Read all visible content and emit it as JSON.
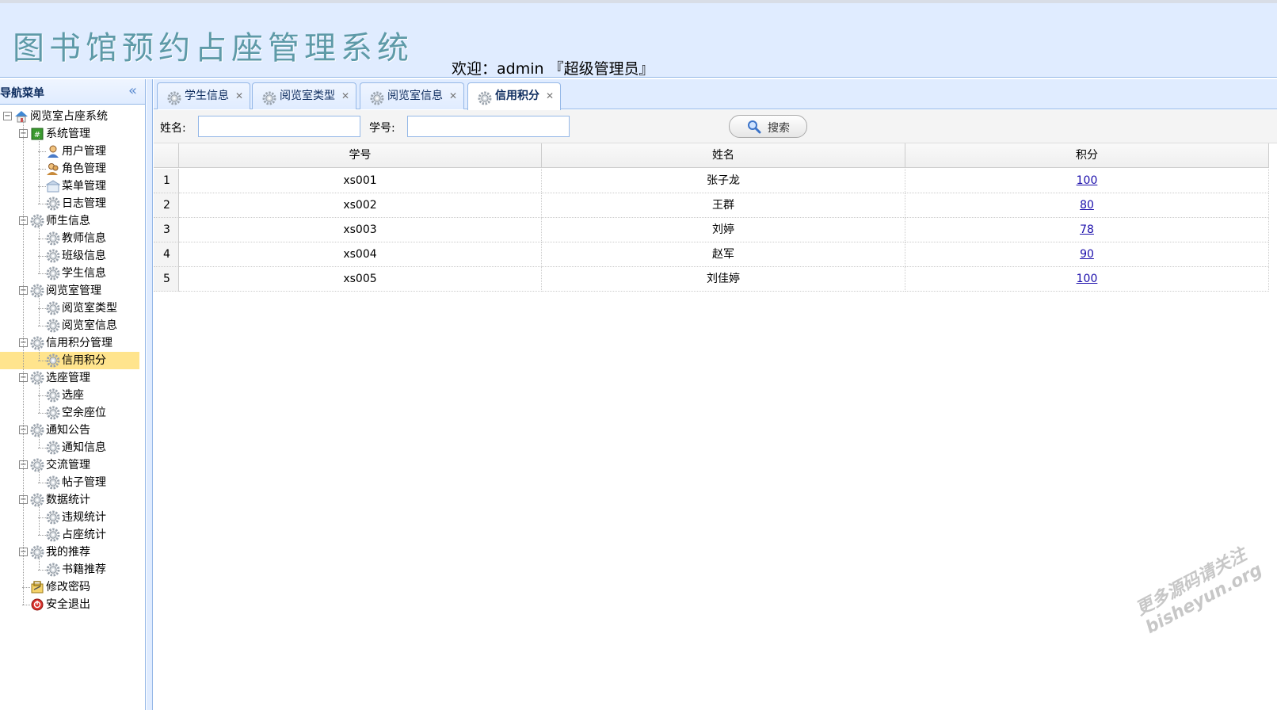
{
  "header": {
    "title": "图书馆预约占座管理系统",
    "welcome": "欢迎：admin 『超级管理员』"
  },
  "nav": {
    "title": "导航菜单",
    "tree": [
      {
        "label": "阅览室占座系统",
        "level": 0,
        "icon": "home-icon",
        "toggle": true
      },
      {
        "label": "系统管理",
        "level": 1,
        "icon": "system-icon",
        "toggle": true
      },
      {
        "label": "用户管理",
        "level": 2,
        "icon": "user-icon"
      },
      {
        "label": "角色管理",
        "level": 2,
        "icon": "role-icon"
      },
      {
        "label": "菜单管理",
        "level": 2,
        "icon": "menu-icon"
      },
      {
        "label": "日志管理",
        "level": 2,
        "icon": "gear-icon"
      },
      {
        "label": "师生信息",
        "level": 1,
        "icon": "gear-icon",
        "toggle": true
      },
      {
        "label": "教师信息",
        "level": 2,
        "icon": "gear-icon"
      },
      {
        "label": "班级信息",
        "level": 2,
        "icon": "gear-icon"
      },
      {
        "label": "学生信息",
        "level": 2,
        "icon": "gear-icon"
      },
      {
        "label": "阅览室管理",
        "level": 1,
        "icon": "gear-icon",
        "toggle": true
      },
      {
        "label": "阅览室类型",
        "level": 2,
        "icon": "gear-icon"
      },
      {
        "label": "阅览室信息",
        "level": 2,
        "icon": "gear-icon"
      },
      {
        "label": "信用积分管理",
        "level": 1,
        "icon": "gear-icon",
        "toggle": true
      },
      {
        "label": "信用积分",
        "level": 2,
        "icon": "gear-icon",
        "selected": true
      },
      {
        "label": "选座管理",
        "level": 1,
        "icon": "gear-icon",
        "toggle": true
      },
      {
        "label": "选座",
        "level": 2,
        "icon": "gear-icon"
      },
      {
        "label": "空余座位",
        "level": 2,
        "icon": "gear-icon"
      },
      {
        "label": "通知公告",
        "level": 1,
        "icon": "gear-icon",
        "toggle": true
      },
      {
        "label": "通知信息",
        "level": 2,
        "icon": "gear-icon"
      },
      {
        "label": "交流管理",
        "level": 1,
        "icon": "gear-icon",
        "toggle": true
      },
      {
        "label": "帖子管理",
        "level": 2,
        "icon": "gear-icon"
      },
      {
        "label": "数据统计",
        "level": 1,
        "icon": "gear-icon",
        "toggle": true
      },
      {
        "label": "违规统计",
        "level": 2,
        "icon": "gear-icon"
      },
      {
        "label": "占座统计",
        "level": 2,
        "icon": "gear-icon"
      },
      {
        "label": "我的推荐",
        "level": 1,
        "icon": "gear-icon",
        "toggle": true
      },
      {
        "label": "书籍推荐",
        "level": 2,
        "icon": "gear-icon"
      },
      {
        "label": "修改密码",
        "level": 1,
        "icon": "password-icon"
      },
      {
        "label": "安全退出",
        "level": 1,
        "icon": "exit-icon"
      }
    ]
  },
  "tabs": [
    {
      "label": "学生信息",
      "active": false
    },
    {
      "label": "阅览室类型",
      "active": false
    },
    {
      "label": "阅览室信息",
      "active": false
    },
    {
      "label": "信用积分",
      "active": true
    }
  ],
  "toolbar": {
    "name_label": "姓名:",
    "name_value": "",
    "id_label": "学号:",
    "id_value": "",
    "search_label": "搜索"
  },
  "grid": {
    "columns": [
      "学号",
      "姓名",
      "积分"
    ],
    "rows": [
      {
        "num": "1",
        "id": "xs001",
        "name": "张子龙",
        "score": "100"
      },
      {
        "num": "2",
        "id": "xs002",
        "name": "王群",
        "score": "80"
      },
      {
        "num": "3",
        "id": "xs003",
        "name": "刘婷",
        "score": "78"
      },
      {
        "num": "4",
        "id": "xs004",
        "name": "赵军",
        "score": "90"
      },
      {
        "num": "5",
        "id": "xs005",
        "name": "刘佳婷",
        "score": "100"
      }
    ]
  },
  "watermark": {
    "line1": "更多源码请关注",
    "line2": "bisheyun.org"
  },
  "colors": {
    "header_bg": "#e0ecff",
    "border": "#95b8e7",
    "selected": "#ffe48d",
    "title": "#5e9aa8"
  }
}
